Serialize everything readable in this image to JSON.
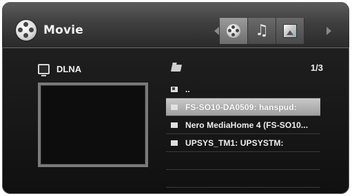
{
  "header": {
    "title": "Movie",
    "tabs": [
      {
        "name": "movie",
        "icon": "movie-reel-icon",
        "active": true
      },
      {
        "name": "music",
        "icon": "music-note-icon",
        "active": false
      },
      {
        "name": "photo",
        "icon": "photo-icon",
        "active": false
      }
    ]
  },
  "device": {
    "label": "DLNA",
    "icon": "monitor-icon"
  },
  "list": {
    "page_info": "1/3",
    "items": [
      {
        "label": "..",
        "icon": "up-folder-icon",
        "selected": false
      },
      {
        "label": "FS-SO10-DA0509: hanspud:",
        "icon": "server-icon",
        "selected": true
      },
      {
        "label": "Nero MediaHome 4 (FS-SO10...",
        "icon": "server-icon",
        "selected": false
      },
      {
        "label": "UPSYS_TM1: UPSYSTM:",
        "icon": "server-icon",
        "selected": false
      }
    ]
  },
  "colors": {
    "background": "#181818",
    "selected_row": "#b5b5b5",
    "text": "#f0f0f0"
  }
}
